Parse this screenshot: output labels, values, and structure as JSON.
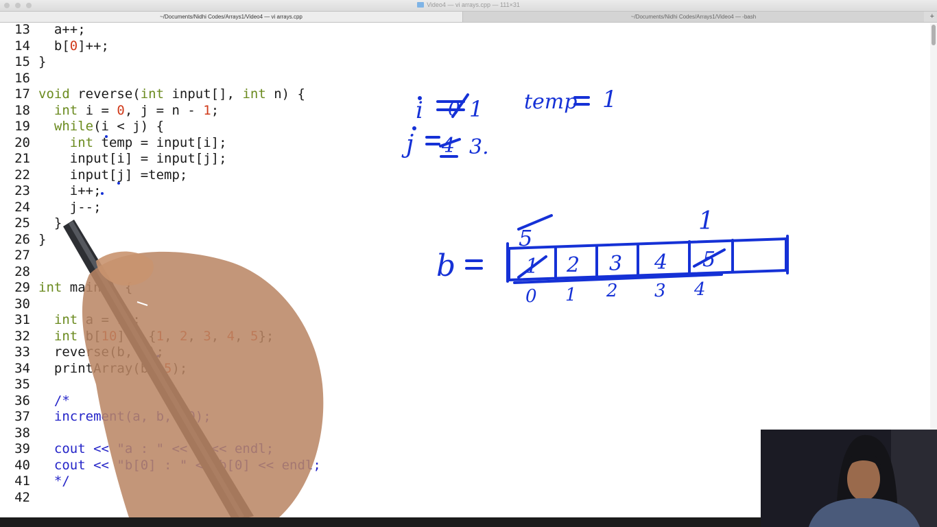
{
  "window": {
    "title": "Video4 — vi arrays.cpp — 111×31",
    "tabs": [
      {
        "label": "~/Documents/Nidhi Codes/Arrays1/Video4 — vi arrays.cpp",
        "active": true
      },
      {
        "label": "~/Documents/Nidhi Codes/Arrays1/Video4 — -bash",
        "active": false
      }
    ],
    "new_tab_label": "+"
  },
  "editor": {
    "lines": [
      {
        "n": "13",
        "tokens": [
          [
            "",
            "  a++;"
          ]
        ]
      },
      {
        "n": "14",
        "tokens": [
          [
            "",
            "  b["
          ],
          [
            "num",
            "0"
          ],
          [
            "",
            "]++;"
          ]
        ]
      },
      {
        "n": "15",
        "tokens": [
          [
            "",
            "}"
          ]
        ]
      },
      {
        "n": "16",
        "tokens": []
      },
      {
        "n": "17",
        "tokens": [
          [
            "kw",
            "void"
          ],
          [
            "",
            " reverse("
          ],
          [
            "kw",
            "int"
          ],
          [
            "",
            " input[], "
          ],
          [
            "kw",
            "int"
          ],
          [
            "",
            " n) {"
          ]
        ]
      },
      {
        "n": "18",
        "tokens": [
          [
            "",
            "  "
          ],
          [
            "kw",
            "int"
          ],
          [
            "",
            " i = "
          ],
          [
            "num",
            "0"
          ],
          [
            "",
            ", j = n - "
          ],
          [
            "num",
            "1"
          ],
          [
            "",
            ";"
          ]
        ]
      },
      {
        "n": "19",
        "tokens": [
          [
            "",
            "  "
          ],
          [
            "kw",
            "while"
          ],
          [
            "",
            "(i < j) {"
          ]
        ]
      },
      {
        "n": "20",
        "tokens": [
          [
            "",
            "    "
          ],
          [
            "kw",
            "int"
          ],
          [
            "",
            " temp = input[i];"
          ]
        ]
      },
      {
        "n": "21",
        "tokens": [
          [
            "",
            "    input[i] = input[j];"
          ]
        ]
      },
      {
        "n": "22",
        "tokens": [
          [
            "",
            "    input[j] =temp;"
          ]
        ]
      },
      {
        "n": "23",
        "tokens": [
          [
            "",
            "    i++;"
          ]
        ]
      },
      {
        "n": "24",
        "tokens": [
          [
            "",
            "    j--;"
          ]
        ]
      },
      {
        "n": "25",
        "tokens": [
          [
            "",
            "  }"
          ]
        ]
      },
      {
        "n": "26",
        "tokens": [
          [
            "",
            "}"
          ]
        ]
      },
      {
        "n": "27",
        "tokens": []
      },
      {
        "n": "28",
        "tokens": []
      },
      {
        "n": "29",
        "tokens": [
          [
            "kw",
            "int"
          ],
          [
            "",
            " main() {"
          ]
        ]
      },
      {
        "n": "30",
        "tokens": []
      },
      {
        "n": "31",
        "tokens": [
          [
            "",
            "  "
          ],
          [
            "kw",
            "int"
          ],
          [
            "",
            " a = "
          ],
          [
            "num",
            "10"
          ],
          [
            "",
            ";"
          ]
        ]
      },
      {
        "n": "32",
        "tokens": [
          [
            "",
            "  "
          ],
          [
            "kw",
            "int"
          ],
          [
            "",
            " b["
          ],
          [
            "num",
            "10"
          ],
          [
            "",
            "] = {"
          ],
          [
            "num",
            "1"
          ],
          [
            "",
            ", "
          ],
          [
            "num",
            "2"
          ],
          [
            "",
            ", "
          ],
          [
            "num",
            "3"
          ],
          [
            "",
            ", "
          ],
          [
            "num",
            "4"
          ],
          [
            "",
            ", "
          ],
          [
            "num",
            "5"
          ],
          [
            "",
            "};"
          ]
        ]
      },
      {
        "n": "33",
        "tokens": [
          [
            "",
            "  reverse(b, "
          ],
          [
            "num",
            "5"
          ],
          [
            "",
            ");"
          ]
        ]
      },
      {
        "n": "34",
        "tokens": [
          [
            "",
            "  printArray(b, "
          ],
          [
            "num",
            "5"
          ],
          [
            "",
            ");"
          ]
        ]
      },
      {
        "n": "35",
        "tokens": []
      },
      {
        "n": "36",
        "tokens": [
          [
            "",
            "  "
          ],
          [
            "cm",
            "/*"
          ]
        ]
      },
      {
        "n": "37",
        "tokens": [
          [
            "",
            "  "
          ],
          [
            "cm",
            "increment(a, b, 10);"
          ]
        ]
      },
      {
        "n": "38",
        "tokens": []
      },
      {
        "n": "39",
        "tokens": [
          [
            "",
            "  "
          ],
          [
            "cm",
            "cout << \"a : \" << a << endl;"
          ]
        ]
      },
      {
        "n": "40",
        "tokens": [
          [
            "",
            "  "
          ],
          [
            "cm",
            "cout << \"b[0] : \" << b[0] << endl;"
          ]
        ]
      },
      {
        "n": "41",
        "tokens": [
          [
            "",
            "  "
          ],
          [
            "cm",
            "*/"
          ]
        ]
      },
      {
        "n": "42",
        "tokens": []
      }
    ]
  },
  "handwriting": {
    "i_label": "i",
    "i_old": "0",
    "i_new": "1",
    "j_label": "j",
    "j_old": "4",
    "j_new": "3.",
    "temp_label": "temp",
    "temp_value": "1",
    "array_label": "b",
    "array_cells": [
      "1",
      "2",
      "3",
      "4",
      "5",
      ""
    ],
    "overwritten_first": "5",
    "overwritten_last": "1",
    "indices": [
      "0",
      "1",
      "2",
      "3",
      "4"
    ]
  },
  "colors": {
    "ink": "#1531d6",
    "keyword": "#6a8a1e",
    "number": "#d03a1a",
    "comment": "#2424c8"
  }
}
